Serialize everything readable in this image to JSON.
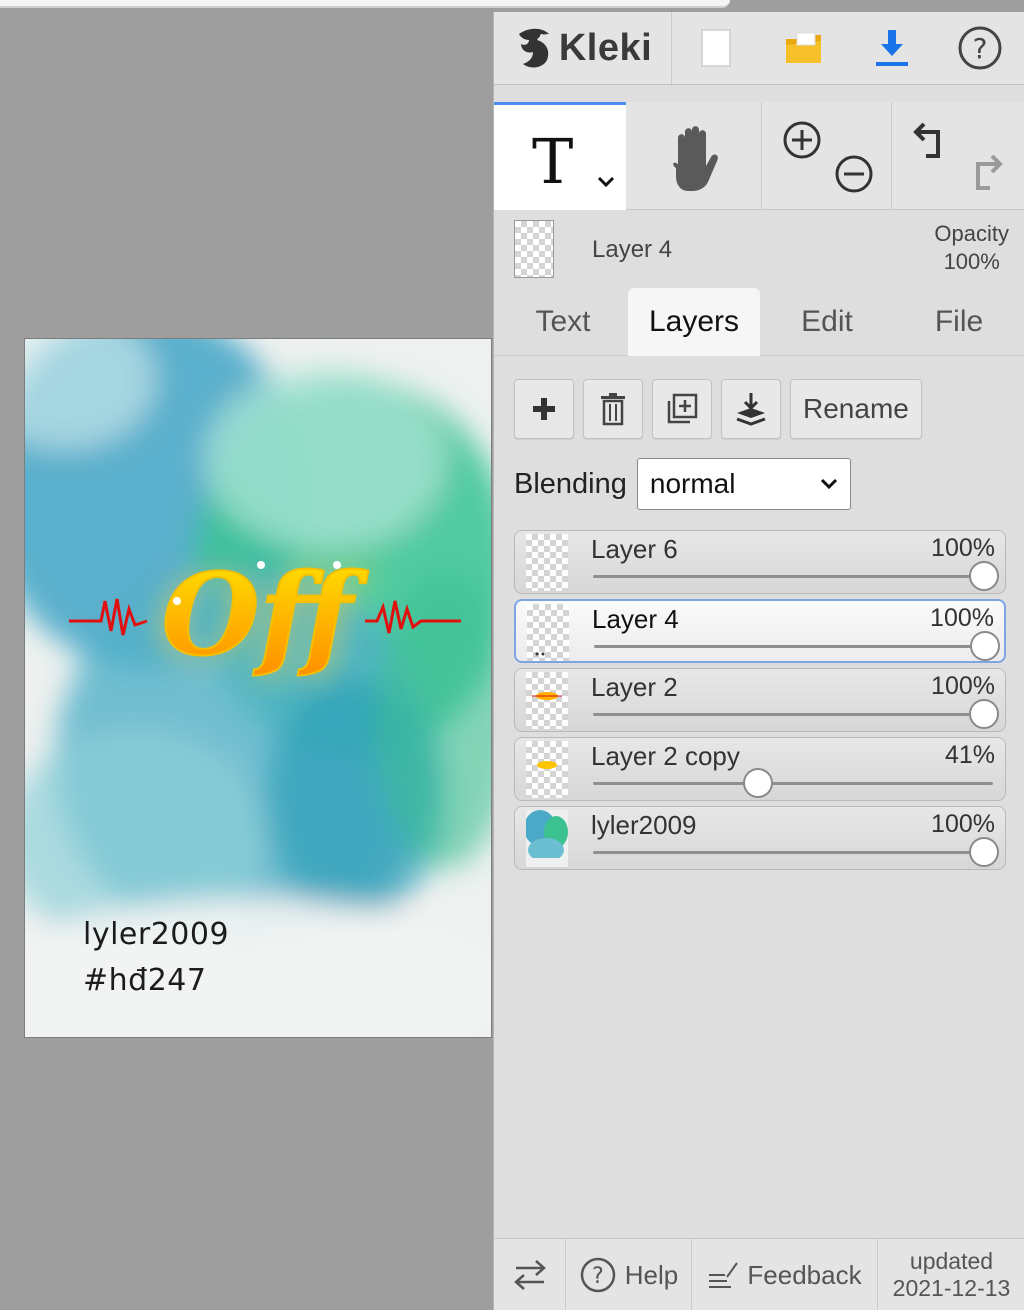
{
  "app": {
    "name": "Kleki"
  },
  "canvas": {
    "artwork_text": "Off",
    "signature": "lyler2009",
    "hashtag": "#hđ247"
  },
  "toolbar": {
    "new_icon": "blank-page-icon",
    "open_icon": "folder-icon",
    "save_icon": "download-icon",
    "help_icon": "question-icon"
  },
  "tools": {
    "active_tool_glyph": "T",
    "active_tool": "text-tool",
    "hand": "hand-icon",
    "zoom_in": "zoom-in-icon",
    "zoom_out": "zoom-out-icon",
    "undo": "undo-icon",
    "redo": "redo-icon"
  },
  "current_layer": {
    "name": "Layer 4",
    "opacity_label": "Opacity",
    "opacity_value": "100%"
  },
  "tabs": [
    {
      "label": "Text",
      "active": false
    },
    {
      "label": "Layers",
      "active": true
    },
    {
      "label": "Edit",
      "active": false
    },
    {
      "label": "File",
      "active": false
    }
  ],
  "layer_actions": {
    "add_icon": "plus-icon",
    "delete_icon": "trash-icon",
    "duplicate_icon": "duplicate-icon",
    "merge_icon": "merge-down-icon",
    "rename_label": "Rename"
  },
  "blending": {
    "label": "Blending",
    "value": "normal"
  },
  "layers": [
    {
      "name": "Layer 6",
      "opacity": "100%",
      "opacity_fraction": 1.0,
      "selected": false,
      "thumb": "empty"
    },
    {
      "name": "Layer 4",
      "opacity": "100%",
      "opacity_fraction": 1.0,
      "selected": true,
      "thumb": "dots"
    },
    {
      "name": "Layer 2",
      "opacity": "100%",
      "opacity_fraction": 1.0,
      "selected": false,
      "thumb": "yellow"
    },
    {
      "name": "Layer 2 copy",
      "opacity": "41%",
      "opacity_fraction": 0.41,
      "selected": false,
      "thumb": "yellow"
    },
    {
      "name": "lyler2009",
      "opacity": "100%",
      "opacity_fraction": 1.0,
      "selected": false,
      "thumb": "watercolor"
    }
  ],
  "footer": {
    "swap_icon": "swap-arrows-icon",
    "help_label": "Help",
    "feedback_label": "Feedback",
    "updated_label": "updated",
    "updated_date": "2021-12-13"
  },
  "colors": {
    "accent": "#4a8ef0",
    "selected_border": "#7ea4e4",
    "folder": "#f5c02a",
    "download": "#1a73e8"
  }
}
